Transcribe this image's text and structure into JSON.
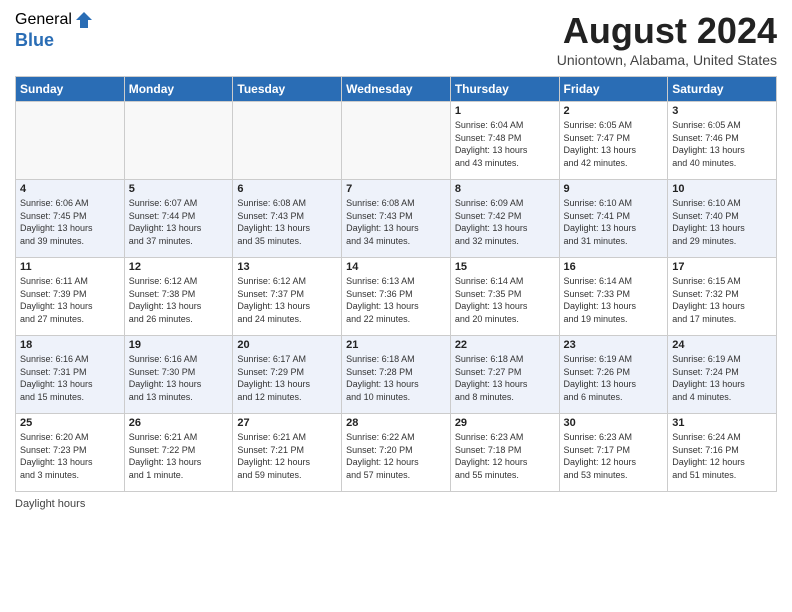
{
  "logo": {
    "general": "General",
    "blue": "Blue"
  },
  "title": "August 2024",
  "location": "Uniontown, Alabama, United States",
  "weekdays": [
    "Sunday",
    "Monday",
    "Tuesday",
    "Wednesday",
    "Thursday",
    "Friday",
    "Saturday"
  ],
  "weeks": [
    [
      {
        "day": "",
        "info": ""
      },
      {
        "day": "",
        "info": ""
      },
      {
        "day": "",
        "info": ""
      },
      {
        "day": "",
        "info": ""
      },
      {
        "day": "1",
        "info": "Sunrise: 6:04 AM\nSunset: 7:48 PM\nDaylight: 13 hours\nand 43 minutes."
      },
      {
        "day": "2",
        "info": "Sunrise: 6:05 AM\nSunset: 7:47 PM\nDaylight: 13 hours\nand 42 minutes."
      },
      {
        "day": "3",
        "info": "Sunrise: 6:05 AM\nSunset: 7:46 PM\nDaylight: 13 hours\nand 40 minutes."
      }
    ],
    [
      {
        "day": "4",
        "info": "Sunrise: 6:06 AM\nSunset: 7:45 PM\nDaylight: 13 hours\nand 39 minutes."
      },
      {
        "day": "5",
        "info": "Sunrise: 6:07 AM\nSunset: 7:44 PM\nDaylight: 13 hours\nand 37 minutes."
      },
      {
        "day": "6",
        "info": "Sunrise: 6:08 AM\nSunset: 7:43 PM\nDaylight: 13 hours\nand 35 minutes."
      },
      {
        "day": "7",
        "info": "Sunrise: 6:08 AM\nSunset: 7:43 PM\nDaylight: 13 hours\nand 34 minutes."
      },
      {
        "day": "8",
        "info": "Sunrise: 6:09 AM\nSunset: 7:42 PM\nDaylight: 13 hours\nand 32 minutes."
      },
      {
        "day": "9",
        "info": "Sunrise: 6:10 AM\nSunset: 7:41 PM\nDaylight: 13 hours\nand 31 minutes."
      },
      {
        "day": "10",
        "info": "Sunrise: 6:10 AM\nSunset: 7:40 PM\nDaylight: 13 hours\nand 29 minutes."
      }
    ],
    [
      {
        "day": "11",
        "info": "Sunrise: 6:11 AM\nSunset: 7:39 PM\nDaylight: 13 hours\nand 27 minutes."
      },
      {
        "day": "12",
        "info": "Sunrise: 6:12 AM\nSunset: 7:38 PM\nDaylight: 13 hours\nand 26 minutes."
      },
      {
        "day": "13",
        "info": "Sunrise: 6:12 AM\nSunset: 7:37 PM\nDaylight: 13 hours\nand 24 minutes."
      },
      {
        "day": "14",
        "info": "Sunrise: 6:13 AM\nSunset: 7:36 PM\nDaylight: 13 hours\nand 22 minutes."
      },
      {
        "day": "15",
        "info": "Sunrise: 6:14 AM\nSunset: 7:35 PM\nDaylight: 13 hours\nand 20 minutes."
      },
      {
        "day": "16",
        "info": "Sunrise: 6:14 AM\nSunset: 7:33 PM\nDaylight: 13 hours\nand 19 minutes."
      },
      {
        "day": "17",
        "info": "Sunrise: 6:15 AM\nSunset: 7:32 PM\nDaylight: 13 hours\nand 17 minutes."
      }
    ],
    [
      {
        "day": "18",
        "info": "Sunrise: 6:16 AM\nSunset: 7:31 PM\nDaylight: 13 hours\nand 15 minutes."
      },
      {
        "day": "19",
        "info": "Sunrise: 6:16 AM\nSunset: 7:30 PM\nDaylight: 13 hours\nand 13 minutes."
      },
      {
        "day": "20",
        "info": "Sunrise: 6:17 AM\nSunset: 7:29 PM\nDaylight: 13 hours\nand 12 minutes."
      },
      {
        "day": "21",
        "info": "Sunrise: 6:18 AM\nSunset: 7:28 PM\nDaylight: 13 hours\nand 10 minutes."
      },
      {
        "day": "22",
        "info": "Sunrise: 6:18 AM\nSunset: 7:27 PM\nDaylight: 13 hours\nand 8 minutes."
      },
      {
        "day": "23",
        "info": "Sunrise: 6:19 AM\nSunset: 7:26 PM\nDaylight: 13 hours\nand 6 minutes."
      },
      {
        "day": "24",
        "info": "Sunrise: 6:19 AM\nSunset: 7:24 PM\nDaylight: 13 hours\nand 4 minutes."
      }
    ],
    [
      {
        "day": "25",
        "info": "Sunrise: 6:20 AM\nSunset: 7:23 PM\nDaylight: 13 hours\nand 3 minutes."
      },
      {
        "day": "26",
        "info": "Sunrise: 6:21 AM\nSunset: 7:22 PM\nDaylight: 13 hours\nand 1 minute."
      },
      {
        "day": "27",
        "info": "Sunrise: 6:21 AM\nSunset: 7:21 PM\nDaylight: 12 hours\nand 59 minutes."
      },
      {
        "day": "28",
        "info": "Sunrise: 6:22 AM\nSunset: 7:20 PM\nDaylight: 12 hours\nand 57 minutes."
      },
      {
        "day": "29",
        "info": "Sunrise: 6:23 AM\nSunset: 7:18 PM\nDaylight: 12 hours\nand 55 minutes."
      },
      {
        "day": "30",
        "info": "Sunrise: 6:23 AM\nSunset: 7:17 PM\nDaylight: 12 hours\nand 53 minutes."
      },
      {
        "day": "31",
        "info": "Sunrise: 6:24 AM\nSunset: 7:16 PM\nDaylight: 12 hours\nand 51 minutes."
      }
    ]
  ],
  "footer": {
    "daylight_label": "Daylight hours"
  }
}
